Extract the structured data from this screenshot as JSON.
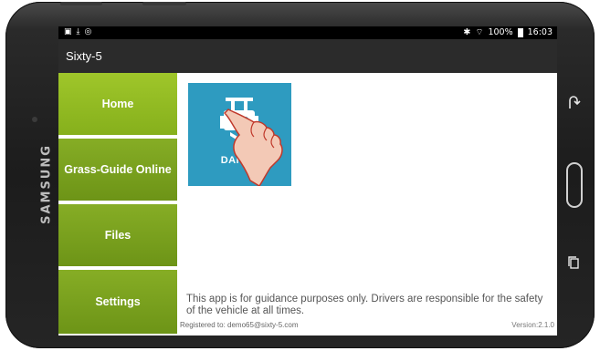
{
  "device": {
    "brand": "SAMSUNG"
  },
  "status_bar": {
    "left_icons": [
      "notification-icon",
      "download-icon",
      "cast-icon"
    ],
    "battery": "100%",
    "time": "16:03"
  },
  "app_bar": {
    "title": "Sixty-5"
  },
  "sidebar": {
    "items": [
      {
        "label": "Home",
        "active": true
      },
      {
        "label": "Grass-Guide Online",
        "active": false
      },
      {
        "label": "Files",
        "active": false
      },
      {
        "label": "Settings",
        "active": false
      }
    ]
  },
  "content": {
    "tile": {
      "label": "DANCE",
      "icon": "tractor-icon",
      "color": "#2e9bc0"
    },
    "disclaimer": "This app is for guidance purposes only. Drivers are responsible for the safety of the vehicle at all times.",
    "registered": "Registered to: demo65@sixty-5.com",
    "version": "Version:2.1.0"
  },
  "colors": {
    "accent": "#86ad25",
    "active": "#9fc62a",
    "appbar": "#2b2b2b"
  }
}
